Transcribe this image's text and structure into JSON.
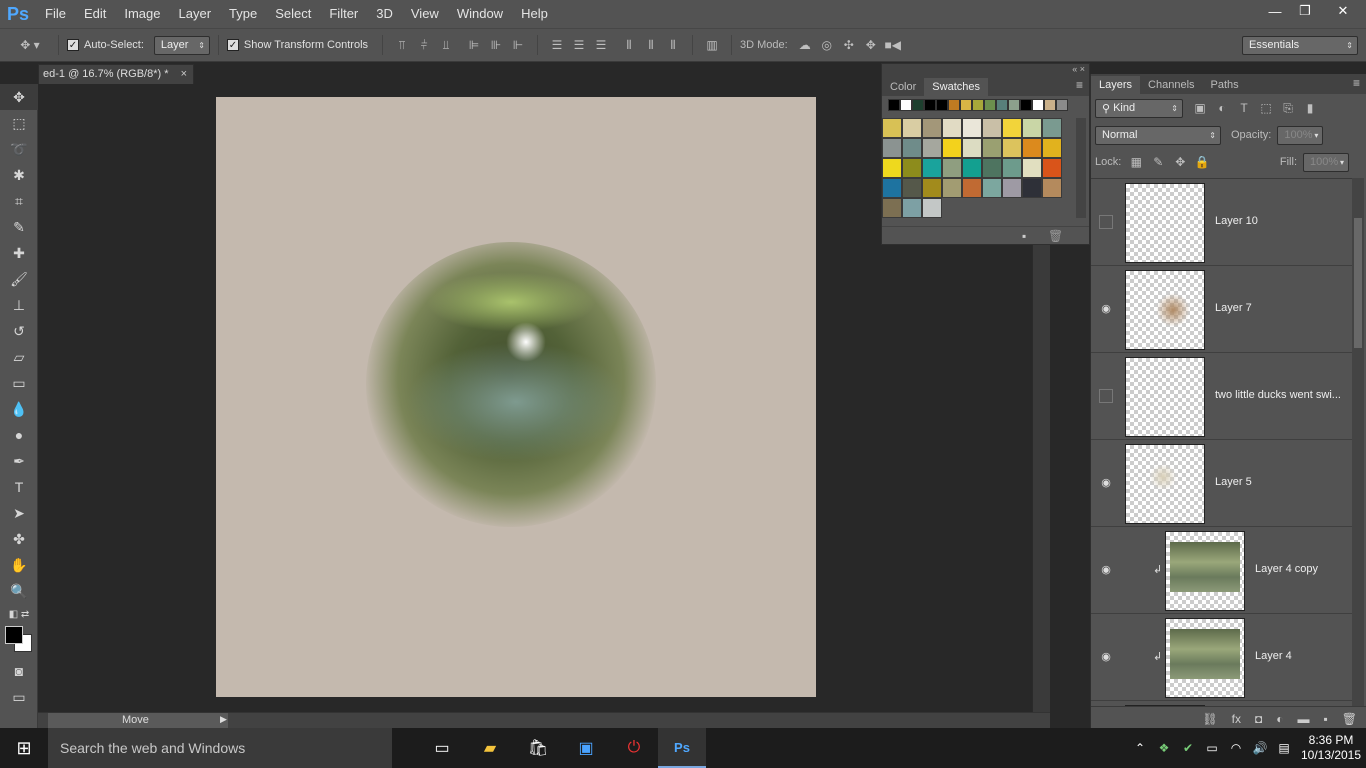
{
  "app": {
    "logo": "Ps"
  },
  "menu": [
    "File",
    "Edit",
    "Image",
    "Layer",
    "Type",
    "Select",
    "Filter",
    "3D",
    "View",
    "Window",
    "Help"
  ],
  "window_controls": {
    "minimize": "—",
    "restore": "❐",
    "close": "✕"
  },
  "options": {
    "auto_select_label": "Auto-Select:",
    "auto_select_value": "Layer",
    "show_transform_label": "Show Transform Controls",
    "mode_label": "3D Mode:",
    "workspace": "Essentials"
  },
  "document": {
    "tab_title": "ed-1 @ 16.7% (RGB/8*) *",
    "close": "×"
  },
  "status": {
    "tool_name": "Move"
  },
  "swatches_panel": {
    "tabs": [
      "Color",
      "Swatches"
    ],
    "active_tab": "Swatches",
    "recent_colors": [
      "#000000",
      "#ffffff",
      "#1d3f2e",
      "#000000",
      "#000000",
      "#bf7b22",
      "#d9b545",
      "#a8a83a",
      "#6c8f4e",
      "#587f7a",
      "#8ca08c",
      "#000000",
      "#ffffff",
      "#c9b08a",
      "#8a8a8a"
    ],
    "grid_colors": [
      "#d8c155",
      "#d9cda3",
      "#a39779",
      "#e1dbc4",
      "#eae6d9",
      "#c9bfa7",
      "#f2d43a",
      "#c9d6a6",
      "#7a9a90",
      "#8b9391",
      "#6f8c8a",
      "#a5a79e",
      "#f3d21c",
      "#dcdcc2",
      "#9aa071",
      "#dcc35d",
      "#dc8a1d",
      "#e1b21e",
      "#eed91e",
      "#8d8c1c",
      "#1aa39c",
      "#8f9e80",
      "#13a090",
      "#4e7460",
      "#6d9b8c",
      "#e1dfc0",
      "#d9541a",
      "#1e73a0",
      "#55584a",
      "#a28b1c",
      "#a29c72",
      "#c06a33",
      "#7ca79f",
      "#9e9aa4",
      "#2e3038",
      "#b48a5d",
      "#7c6f52",
      "#7da0a4",
      "#c3c7c6"
    ]
  },
  "layers_panel": {
    "tabs": [
      "Layers",
      "Channels",
      "Paths"
    ],
    "active_tab": "Layers",
    "filter_kind": "Kind",
    "blend_mode": "Normal",
    "opacity_label": "Opacity:",
    "opacity_value": "100%",
    "lock_label": "Lock:",
    "fill_label": "Fill:",
    "fill_value": "100%",
    "layers": [
      {
        "name": "Layer 10",
        "visible": false,
        "clipped": false
      },
      {
        "name": "Layer 7",
        "visible": true,
        "clipped": false
      },
      {
        "name": "two little ducks went swi...",
        "visible": false,
        "clipped": false
      },
      {
        "name": "Layer 5",
        "visible": true,
        "clipped": false
      },
      {
        "name": "Layer 4 copy",
        "visible": true,
        "clipped": true
      },
      {
        "name": "Layer 4",
        "visible": true,
        "clipped": true
      }
    ]
  },
  "taskbar": {
    "search_placeholder": "Search the web and Windows",
    "time": "8:36 PM",
    "date": "10/13/2015"
  }
}
